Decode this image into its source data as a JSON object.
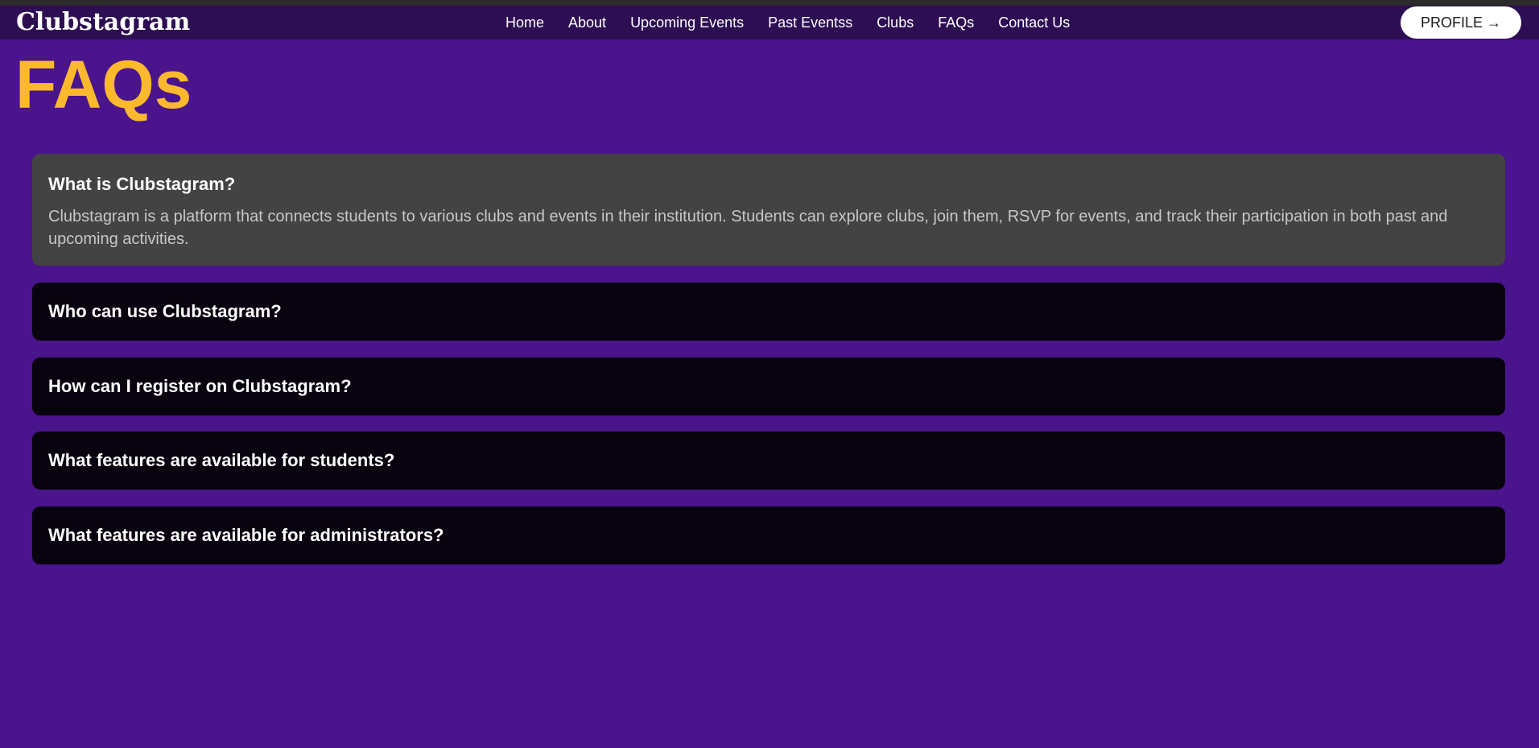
{
  "nav": {
    "brand": "Clubstagram",
    "links": [
      "Home",
      "About",
      "Upcoming Events",
      "Past Eventss",
      "Clubs",
      "FAQs",
      "Contact Us"
    ],
    "profile_label": "PROFILE →"
  },
  "page": {
    "title": "FAQs"
  },
  "faqs": [
    {
      "question": "What is Clubstagram?",
      "answer": "Clubstagram is a platform that connects students to various clubs and events in their institution. Students can explore clubs, join them, RSVP for events, and track their participation in both past and upcoming activities.",
      "expanded": true
    },
    {
      "question": "Who can use Clubstagram?",
      "expanded": false
    },
    {
      "question": "How can I register on Clubstagram?",
      "expanded": false
    },
    {
      "question": "What features are available for students?",
      "expanded": false
    },
    {
      "question": "What features are available for administrators?",
      "expanded": false
    }
  ],
  "colors": {
    "page_bg": "#4a148c",
    "navbar_bg": "#2d0e53",
    "accent": "#fdb92e",
    "faq_open_bg": "#434343",
    "faq_closed_bg": "#08030f"
  }
}
